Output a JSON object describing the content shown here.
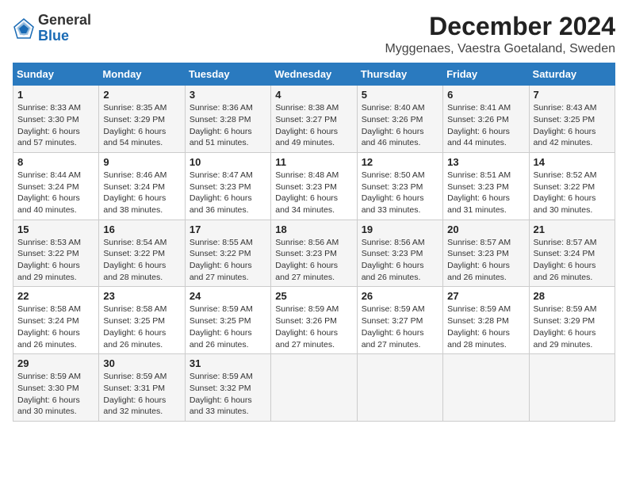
{
  "header": {
    "logo_general": "General",
    "logo_blue": "Blue",
    "title": "December 2024",
    "subtitle": "Myggenaes, Vaestra Goetaland, Sweden"
  },
  "days_of_week": [
    "Sunday",
    "Monday",
    "Tuesday",
    "Wednesday",
    "Thursday",
    "Friday",
    "Saturday"
  ],
  "weeks": [
    [
      {
        "day": "1",
        "sunrise": "Sunrise: 8:33 AM",
        "sunset": "Sunset: 3:30 PM",
        "daylight": "Daylight: 6 hours and 57 minutes."
      },
      {
        "day": "2",
        "sunrise": "Sunrise: 8:35 AM",
        "sunset": "Sunset: 3:29 PM",
        "daylight": "Daylight: 6 hours and 54 minutes."
      },
      {
        "day": "3",
        "sunrise": "Sunrise: 8:36 AM",
        "sunset": "Sunset: 3:28 PM",
        "daylight": "Daylight: 6 hours and 51 minutes."
      },
      {
        "day": "4",
        "sunrise": "Sunrise: 8:38 AM",
        "sunset": "Sunset: 3:27 PM",
        "daylight": "Daylight: 6 hours and 49 minutes."
      },
      {
        "day": "5",
        "sunrise": "Sunrise: 8:40 AM",
        "sunset": "Sunset: 3:26 PM",
        "daylight": "Daylight: 6 hours and 46 minutes."
      },
      {
        "day": "6",
        "sunrise": "Sunrise: 8:41 AM",
        "sunset": "Sunset: 3:26 PM",
        "daylight": "Daylight: 6 hours and 44 minutes."
      },
      {
        "day": "7",
        "sunrise": "Sunrise: 8:43 AM",
        "sunset": "Sunset: 3:25 PM",
        "daylight": "Daylight: 6 hours and 42 minutes."
      }
    ],
    [
      {
        "day": "8",
        "sunrise": "Sunrise: 8:44 AM",
        "sunset": "Sunset: 3:24 PM",
        "daylight": "Daylight: 6 hours and 40 minutes."
      },
      {
        "day": "9",
        "sunrise": "Sunrise: 8:46 AM",
        "sunset": "Sunset: 3:24 PM",
        "daylight": "Daylight: 6 hours and 38 minutes."
      },
      {
        "day": "10",
        "sunrise": "Sunrise: 8:47 AM",
        "sunset": "Sunset: 3:23 PM",
        "daylight": "Daylight: 6 hours and 36 minutes."
      },
      {
        "day": "11",
        "sunrise": "Sunrise: 8:48 AM",
        "sunset": "Sunset: 3:23 PM",
        "daylight": "Daylight: 6 hours and 34 minutes."
      },
      {
        "day": "12",
        "sunrise": "Sunrise: 8:50 AM",
        "sunset": "Sunset: 3:23 PM",
        "daylight": "Daylight: 6 hours and 33 minutes."
      },
      {
        "day": "13",
        "sunrise": "Sunrise: 8:51 AM",
        "sunset": "Sunset: 3:23 PM",
        "daylight": "Daylight: 6 hours and 31 minutes."
      },
      {
        "day": "14",
        "sunrise": "Sunrise: 8:52 AM",
        "sunset": "Sunset: 3:22 PM",
        "daylight": "Daylight: 6 hours and 30 minutes."
      }
    ],
    [
      {
        "day": "15",
        "sunrise": "Sunrise: 8:53 AM",
        "sunset": "Sunset: 3:22 PM",
        "daylight": "Daylight: 6 hours and 29 minutes."
      },
      {
        "day": "16",
        "sunrise": "Sunrise: 8:54 AM",
        "sunset": "Sunset: 3:22 PM",
        "daylight": "Daylight: 6 hours and 28 minutes."
      },
      {
        "day": "17",
        "sunrise": "Sunrise: 8:55 AM",
        "sunset": "Sunset: 3:22 PM",
        "daylight": "Daylight: 6 hours and 27 minutes."
      },
      {
        "day": "18",
        "sunrise": "Sunrise: 8:56 AM",
        "sunset": "Sunset: 3:23 PM",
        "daylight": "Daylight: 6 hours and 27 minutes."
      },
      {
        "day": "19",
        "sunrise": "Sunrise: 8:56 AM",
        "sunset": "Sunset: 3:23 PM",
        "daylight": "Daylight: 6 hours and 26 minutes."
      },
      {
        "day": "20",
        "sunrise": "Sunrise: 8:57 AM",
        "sunset": "Sunset: 3:23 PM",
        "daylight": "Daylight: 6 hours and 26 minutes."
      },
      {
        "day": "21",
        "sunrise": "Sunrise: 8:57 AM",
        "sunset": "Sunset: 3:24 PM",
        "daylight": "Daylight: 6 hours and 26 minutes."
      }
    ],
    [
      {
        "day": "22",
        "sunrise": "Sunrise: 8:58 AM",
        "sunset": "Sunset: 3:24 PM",
        "daylight": "Daylight: 6 hours and 26 minutes."
      },
      {
        "day": "23",
        "sunrise": "Sunrise: 8:58 AM",
        "sunset": "Sunset: 3:25 PM",
        "daylight": "Daylight: 6 hours and 26 minutes."
      },
      {
        "day": "24",
        "sunrise": "Sunrise: 8:59 AM",
        "sunset": "Sunset: 3:25 PM",
        "daylight": "Daylight: 6 hours and 26 minutes."
      },
      {
        "day": "25",
        "sunrise": "Sunrise: 8:59 AM",
        "sunset": "Sunset: 3:26 PM",
        "daylight": "Daylight: 6 hours and 27 minutes."
      },
      {
        "day": "26",
        "sunrise": "Sunrise: 8:59 AM",
        "sunset": "Sunset: 3:27 PM",
        "daylight": "Daylight: 6 hours and 27 minutes."
      },
      {
        "day": "27",
        "sunrise": "Sunrise: 8:59 AM",
        "sunset": "Sunset: 3:28 PM",
        "daylight": "Daylight: 6 hours and 28 minutes."
      },
      {
        "day": "28",
        "sunrise": "Sunrise: 8:59 AM",
        "sunset": "Sunset: 3:29 PM",
        "daylight": "Daylight: 6 hours and 29 minutes."
      }
    ],
    [
      {
        "day": "29",
        "sunrise": "Sunrise: 8:59 AM",
        "sunset": "Sunset: 3:30 PM",
        "daylight": "Daylight: 6 hours and 30 minutes."
      },
      {
        "day": "30",
        "sunrise": "Sunrise: 8:59 AM",
        "sunset": "Sunset: 3:31 PM",
        "daylight": "Daylight: 6 hours and 32 minutes."
      },
      {
        "day": "31",
        "sunrise": "Sunrise: 8:59 AM",
        "sunset": "Sunset: 3:32 PM",
        "daylight": "Daylight: 6 hours and 33 minutes."
      },
      null,
      null,
      null,
      null
    ]
  ]
}
